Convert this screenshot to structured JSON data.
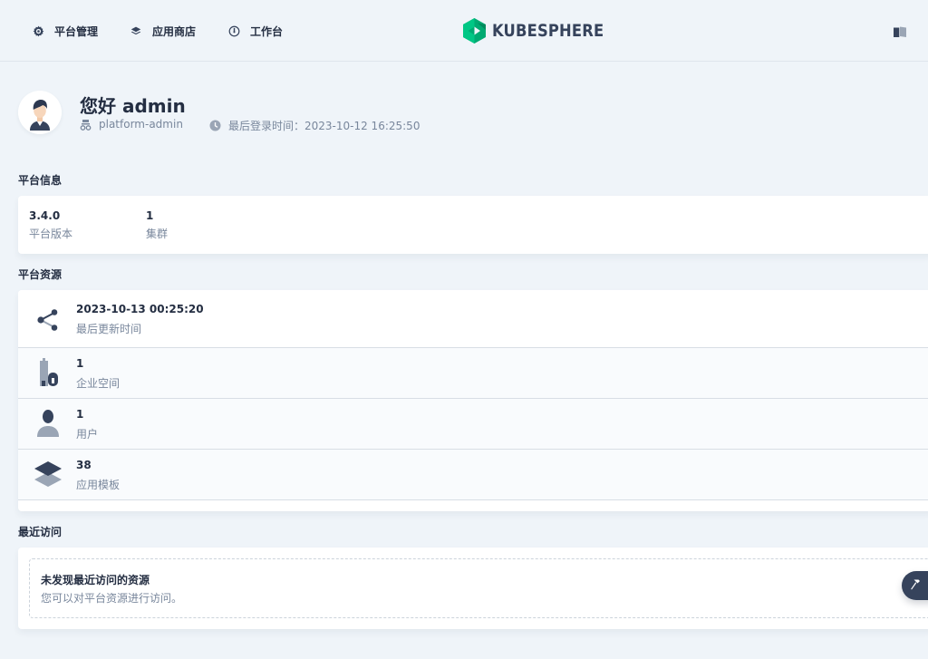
{
  "nav": {
    "items": [
      {
        "label": "平台管理",
        "icon": "gear-icon"
      },
      {
        "label": "应用商店",
        "icon": "layers-icon"
      },
      {
        "label": "工作台",
        "icon": "dashboard-icon"
      }
    ],
    "logo_text": "KUBESPHERE"
  },
  "user": {
    "greeting": "您好 admin",
    "role": "platform-admin",
    "last_login": "最后登录时间：2023-10-12 16:25:50"
  },
  "platform_info": {
    "title": "平台信息",
    "items": [
      {
        "value": "3.4.0",
        "label": "平台版本"
      },
      {
        "value": "1",
        "label": "集群"
      }
    ]
  },
  "platform_resources": {
    "title": "平台资源",
    "items": [
      {
        "value": "2023-10-13 00:25:20",
        "label": "最后更新时间",
        "icon": "share-nodes-icon"
      },
      {
        "value": "1",
        "label": "企业空间",
        "icon": "enterprise-icon"
      },
      {
        "value": "1",
        "label": "用户",
        "icon": "user-icon"
      },
      {
        "value": "38",
        "label": "应用模板",
        "icon": "app-template-icon"
      }
    ]
  },
  "recent": {
    "title": "最近访问",
    "empty_title": "未发现最近访问的资源",
    "empty_desc": "您可以对平台资源进行访问。"
  },
  "colors": {
    "brand_green": "#00aa72",
    "text_primary": "#242e42",
    "text_secondary": "#79879c",
    "background": "#eff4f9"
  }
}
